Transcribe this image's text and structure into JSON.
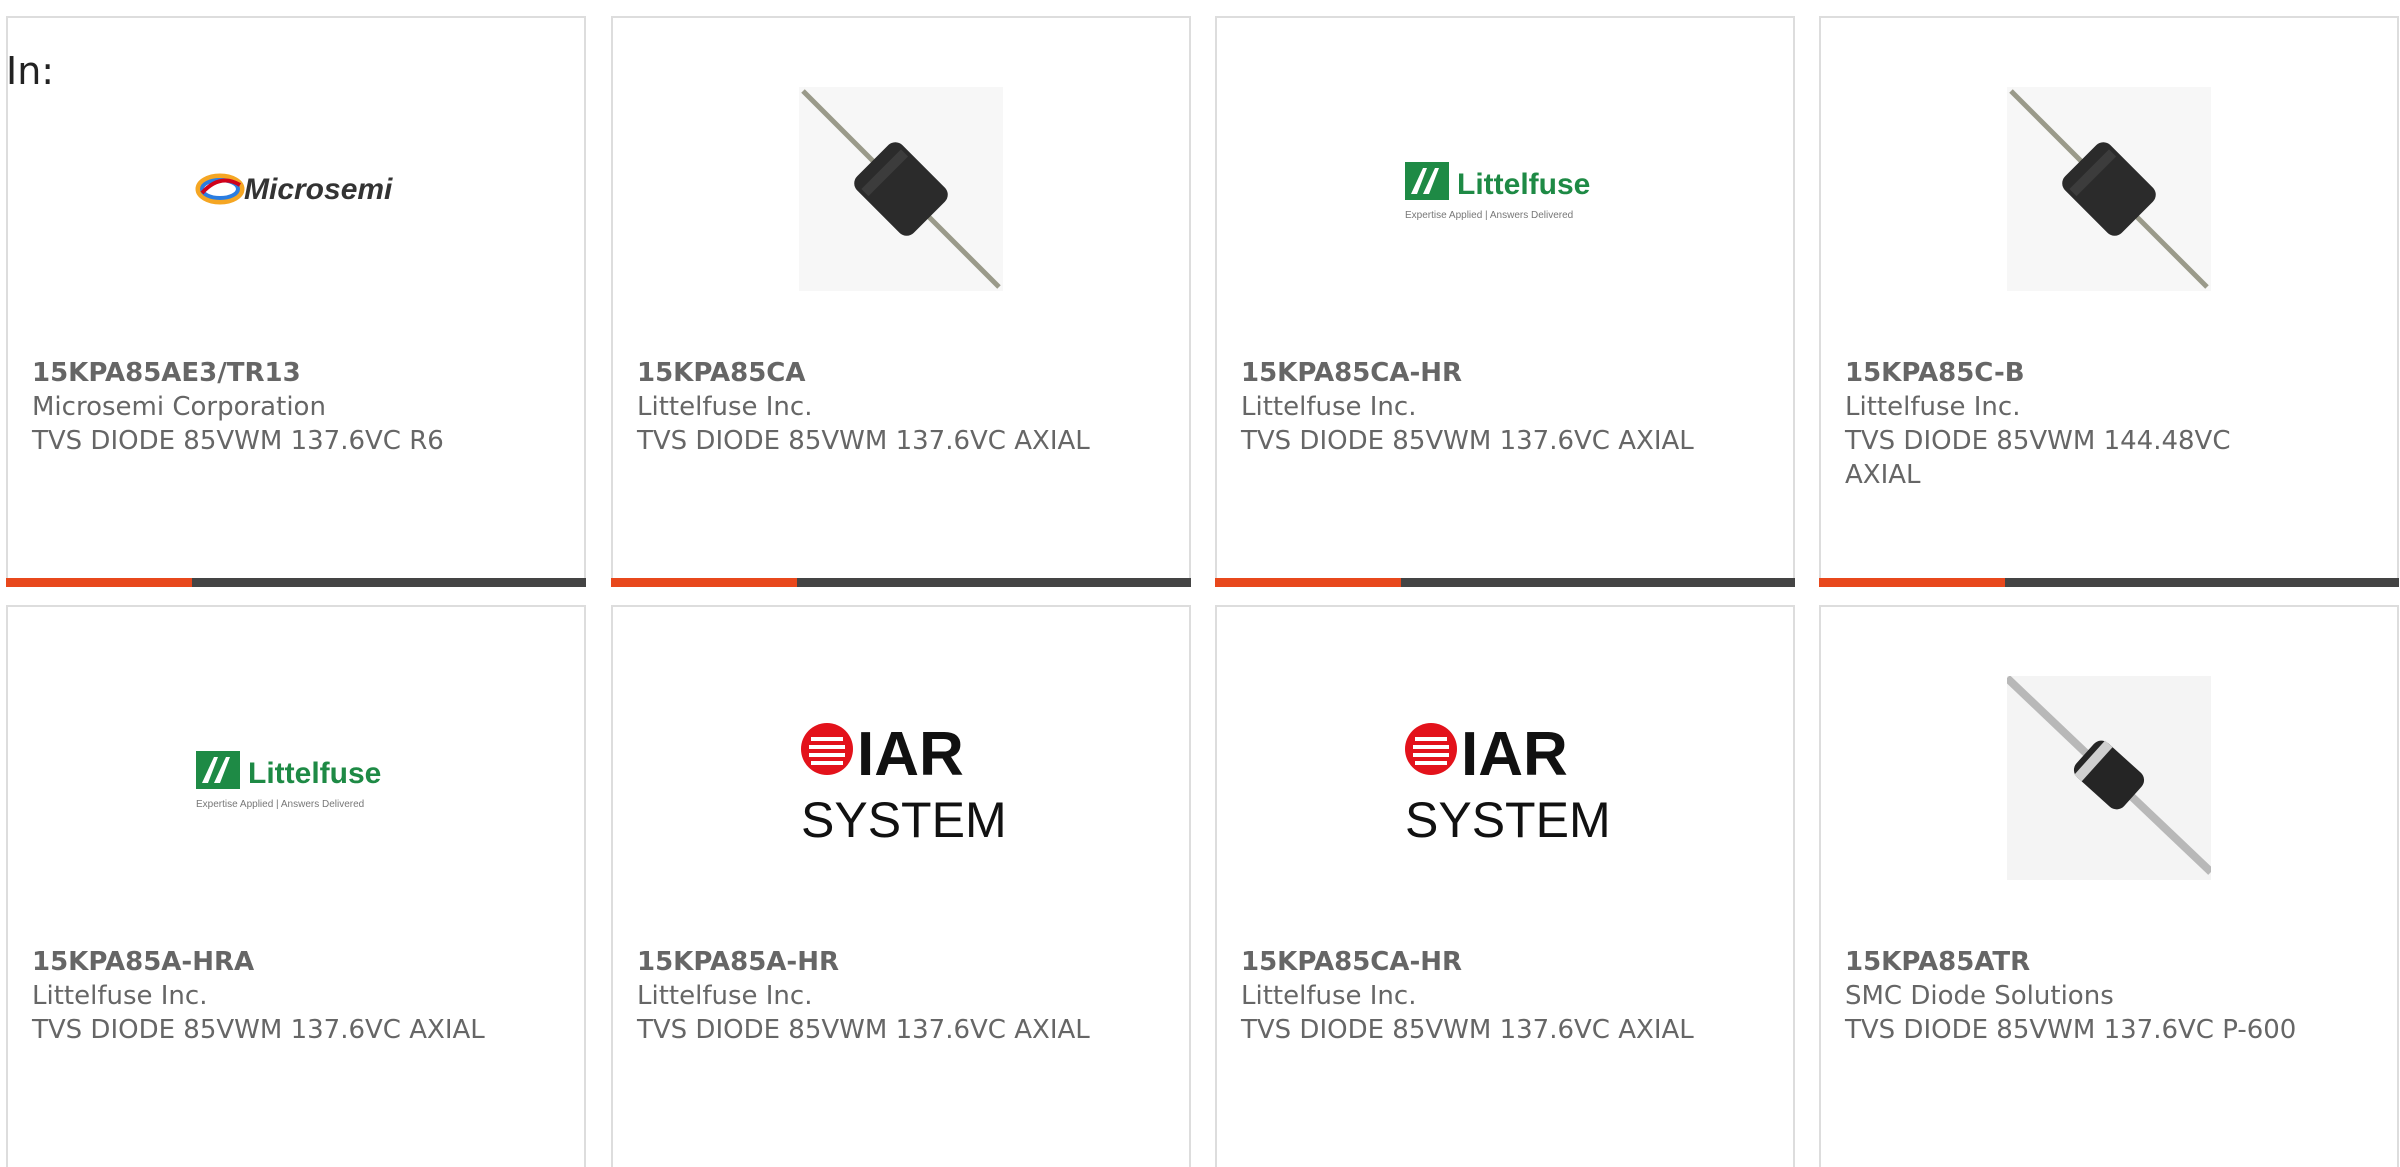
{
  "filter": {
    "label": "In:"
  },
  "cards": [
    {
      "part_number": "15KPA85AE3/TR13",
      "manufacturer": "Microsemi Corporation",
      "description": "TVS DIODE 85VWM 137.6VC R6",
      "image": "microsemi-logo"
    },
    {
      "part_number": "15KPA85CA",
      "manufacturer": "Littelfuse Inc.",
      "description": "TVS DIODE 85VWM 137.6VC AXIAL",
      "image": "axial-diode-photo"
    },
    {
      "part_number": "15KPA85CA-HR",
      "manufacturer": "Littelfuse Inc.",
      "description": "TVS DIODE 85VWM 137.6VC AXIAL",
      "image": "littelfuse-logo"
    },
    {
      "part_number": "15KPA85C-B",
      "manufacturer": "Littelfuse Inc.",
      "description": "TVS DIODE 85VWM 144.48VC AXIAL",
      "image": "axial-diode-photo"
    },
    {
      "part_number": "15KPA85A-HRA",
      "manufacturer": "Littelfuse Inc.",
      "description": "TVS DIODE 85VWM 137.6VC AXIAL",
      "image": "littelfuse-logo"
    },
    {
      "part_number": "15KPA85A-HR",
      "manufacturer": "Littelfuse Inc.",
      "description": "TVS DIODE 85VWM 137.6VC AXIAL",
      "image": "iar-systems-logo"
    },
    {
      "part_number": "15KPA85CA-HR",
      "manufacturer": "Littelfuse Inc.",
      "description": "TVS DIODE 85VWM 137.6VC AXIAL",
      "image": "iar-systems-logo"
    },
    {
      "part_number": "15KPA85ATR",
      "manufacturer": "SMC Diode Solutions",
      "description": "TVS DIODE 85VWM 137.6VC P-600",
      "image": "p600-diode-photo"
    }
  ],
  "logos": {
    "microsemi": "Microsemi",
    "littelfuse": "Littelfuse",
    "littelfuse_tagline": "Expertise Applied | Answers Delivered",
    "iar": "IAR",
    "iar_systems": "SYSTEMS"
  },
  "colors": {
    "accent": "#e8481c",
    "bar": "#444444",
    "text": "#666666",
    "border": "#dddddd",
    "littelfuse_green": "#1e8a45",
    "iar_red": "#e3121b"
  }
}
